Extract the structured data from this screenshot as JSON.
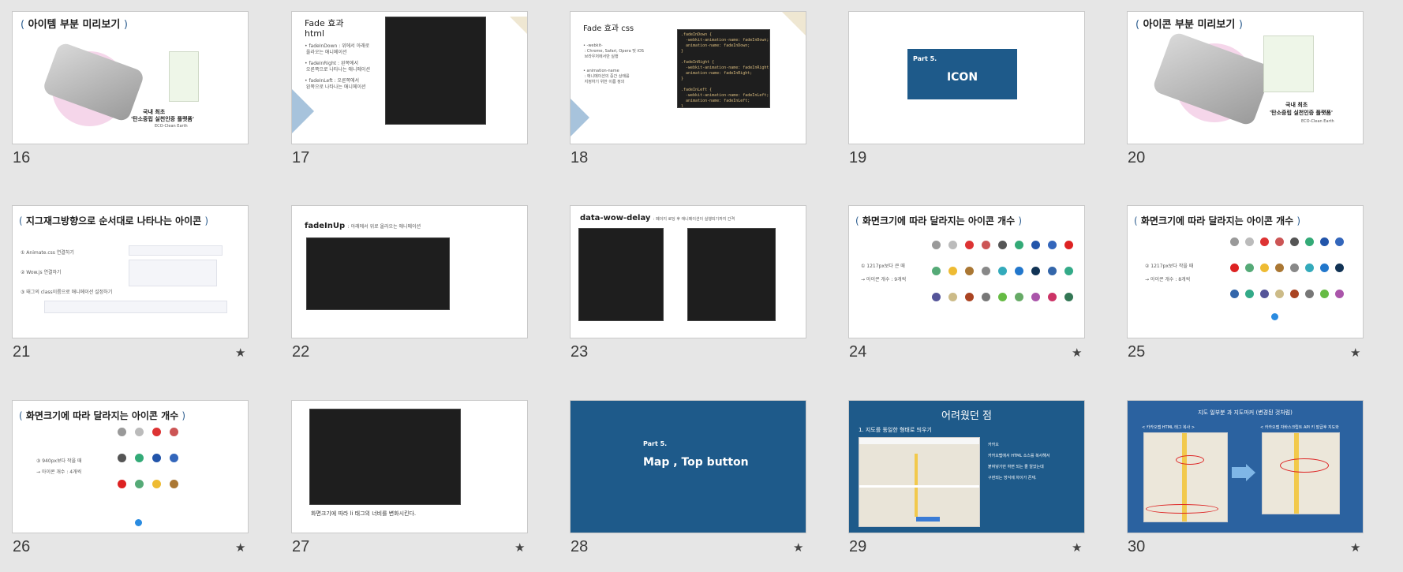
{
  "slides": [
    {
      "num": "16",
      "title": "아이템 부분 미리보기",
      "caption1": "국내 최초",
      "caption2": "'탄소중립 실천인증 플랫폼'",
      "caption3": "ECO-Clean Earth"
    },
    {
      "num": "17",
      "title": "Fade 효과\nhtml",
      "bullets": [
        "• fadeInDown : 위에서 아래로 \n 올라오는 애니메이션",
        "• fadeInRight : 왼쪽에서 \n 오른쪽으로 나타나는 애니메이션",
        "• fadeInLeft : 오른쪽에서 \n 왼쪽으로 나타나는 애니메이션"
      ]
    },
    {
      "num": "18",
      "title": "Fade 효과 css",
      "bullets": [
        "• -webkit- \n : Chrome, Safari, Opera 및 iOS \n 브라우저에서만 실행",
        "• animation-name \n : 애니메이션의 중간 상태를 \n 지정하기 위한 이름 정의"
      ],
      "code": ".fadeInDown {\n  -webkit-animation-name: fadeInDown;\n  animation-name: fadeInDown;\n}\n\n.fadeInRight {\n  -webkit-animation-name: fadeInRight;\n  animation-name: fadeInRight;\n}\n\n.fadeInLeft {\n  -webkit-animation-name: fadeInLeft;\n  animation-name: fadeInLeft;\n}"
    },
    {
      "num": "19",
      "part": "Part 5.",
      "label": "ICON"
    },
    {
      "num": "20",
      "title": "아이콘 부분 미리보기",
      "caption1": "국내 최초",
      "caption2": "'탄소중립 실천인증 플랫폼'",
      "caption3": "ECO-Clean Earth"
    },
    {
      "num": "21",
      "title": "지그재그방향으로 순서대로 나타나는 아이콘",
      "items": [
        "① Animate.css 연결하기",
        "② Wow.js 연결하기",
        "③ 태그의 class이름으로 애니메이션 설정하기"
      ]
    },
    {
      "num": "22",
      "title": "fadeInUp",
      "subtitle": ": 아래에서 위로 올라오는 애니메이션"
    },
    {
      "num": "23",
      "title": "data-wow-delay",
      "subtitle": ": 페이지 로딩 후 애니메이션이 실행되기까지 간격"
    },
    {
      "num": "24",
      "title": "화면크기에 따라 달라지는 아이콘 개수",
      "line1": "① 1217px보다 큰 때",
      "line2": "→ 아이콘 개수 : 9개씩"
    },
    {
      "num": "25",
      "title": "화면크기에 따라 달라지는 아이콘 개수",
      "line1": "② 1217px보다 작을 때",
      "line2": "→ 아이콘 개수 : 8개씩"
    },
    {
      "num": "26",
      "title": "화면크기에 따라 달라지는 아이콘 개수",
      "line1": "③ 940px보다 작을 때",
      "line2": "→ 아이콘 개수 : 4개씩"
    },
    {
      "num": "27",
      "caption": "화면크기에 따라 li 태그의 너비를 변화시킨다."
    },
    {
      "num": "28",
      "part": "Part 5.",
      "label": "Map , Top button"
    },
    {
      "num": "29",
      "title": "어려웠던 점",
      "subtitle": "1. 지도를 동일한 형태로 띄우기",
      "note1": "카카오",
      "note2": "카카오맵에서 HTML 소스를 복사해서",
      "note3": "붙여넣기만 하면 되는 줄 알았는데",
      "note4": "구현되는 방식에 차이가 존재."
    },
    {
      "num": "30",
      "title": "지도 일부분 과 지도마커 (변경된 것처럼)",
      "left": "< 카카오맵 HTML 태그 복사 >",
      "right": "< 카카오맵 자바스크립트 API 키 발급후 지도와"
    }
  ]
}
